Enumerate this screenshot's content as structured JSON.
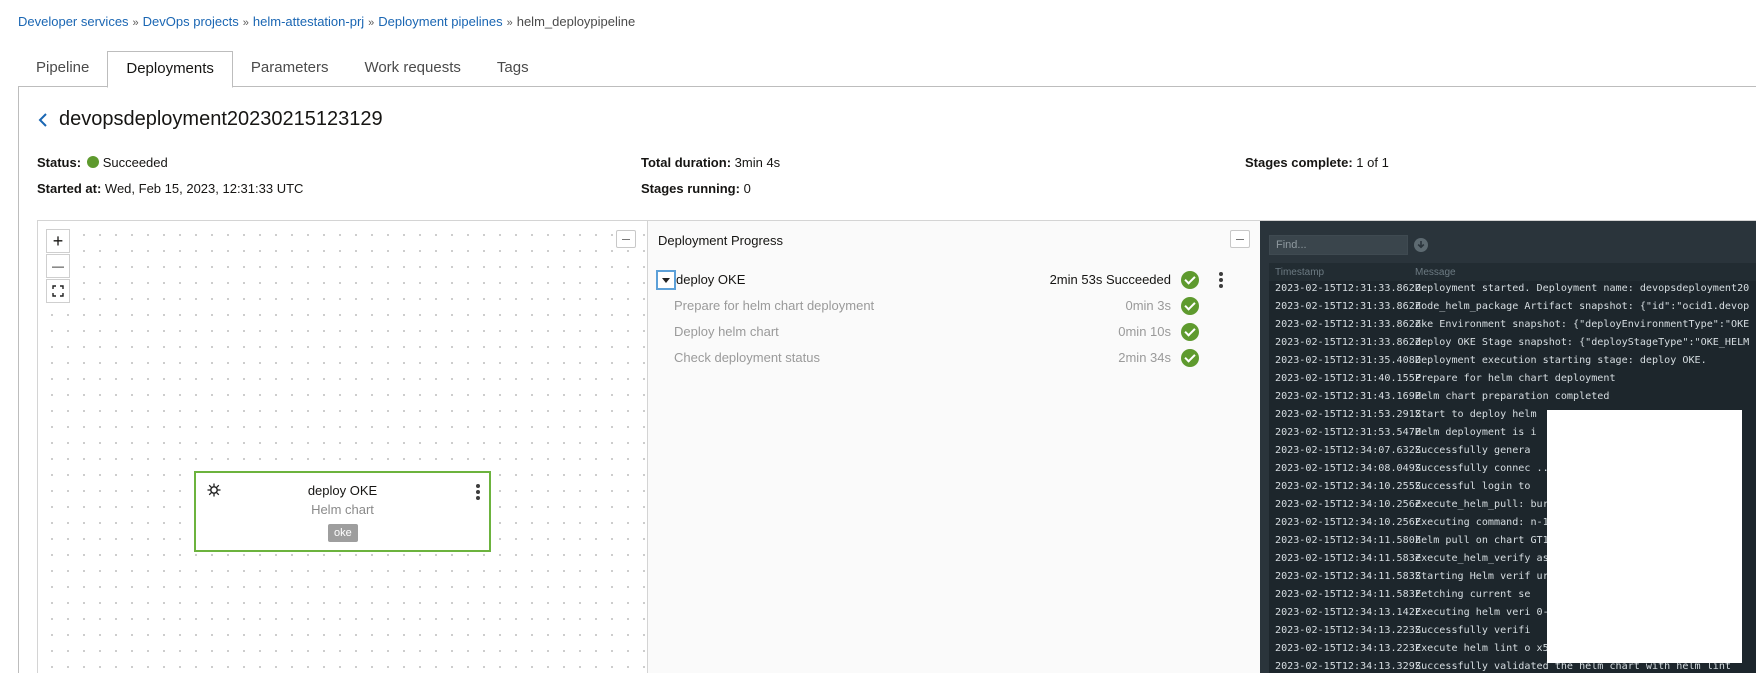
{
  "breadcrumb": {
    "items": [
      "Developer services",
      "DevOps projects",
      "helm-attestation-prj",
      "Deployment pipelines"
    ],
    "current": "helm_deploypipeline",
    "separator": "»"
  },
  "tabs": [
    {
      "label": "Pipeline",
      "active": false
    },
    {
      "label": "Deployments",
      "active": true
    },
    {
      "label": "Parameters",
      "active": false
    },
    {
      "label": "Work requests",
      "active": false
    },
    {
      "label": "Tags",
      "active": false
    }
  ],
  "deployment": {
    "title": "devopsdeployment20230215123129",
    "status_label": "Status:",
    "status_value": "Succeeded",
    "started_label": "Started at:",
    "started_value": "Wed, Feb 15, 2023, 12:31:33 UTC",
    "duration_label": "Total duration:",
    "duration_value": "3min 4s",
    "running_label": "Stages running:",
    "running_value": "0",
    "complete_label": "Stages complete:",
    "complete_value": "1 of 1"
  },
  "canvas": {
    "zoom_in": "+",
    "zoom_out": "—",
    "node": {
      "title": "deploy OKE",
      "subtitle": "Helm chart",
      "tag": "oke"
    }
  },
  "progress": {
    "title": "Deployment Progress",
    "stage": {
      "name": "deploy OKE",
      "time_status": "2min 53s Succeeded"
    },
    "steps": [
      {
        "name": "Prepare for helm chart deployment",
        "time": "0min 3s"
      },
      {
        "name": "Deploy helm chart",
        "time": "0min 10s"
      },
      {
        "name": "Check deployment status",
        "time": "2min 34s"
      }
    ]
  },
  "logs": {
    "find_placeholder": "Find...",
    "col_timestamp": "Timestamp",
    "col_message": "Message",
    "rows": [
      {
        "ts": "2023-02-15T12:31:33.862Z",
        "msg": "Deployment started. Deployment name: devopsdeployment20"
      },
      {
        "ts": "2023-02-15T12:31:33.862Z",
        "msg": "node_helm_package Artifact snapshot: {\"id\":\"ocid1.devop"
      },
      {
        "ts": "2023-02-15T12:31:33.862Z",
        "msg": "oke Environment snapshot: {\"deployEnvironmentType\":\"OKE"
      },
      {
        "ts": "2023-02-15T12:31:33.862Z",
        "msg": "deploy OKE Stage snapshot: {\"deployStageType\":\"OKE_HELM"
      },
      {
        "ts": "2023-02-15T12:31:35.408Z",
        "msg": "Deployment execution starting stage: deploy OKE."
      },
      {
        "ts": "2023-02-15T12:31:40.155Z",
        "msg": "Prepare for helm chart deployment"
      },
      {
        "ts": "2023-02-15T12:31:43.169Z",
        "msg": "Helm chart preparation completed"
      },
      {
        "ts": "2023-02-15T12:31:53.291Z",
        "msg": "Start to deploy helm"
      },
      {
        "ts": "2023-02-15T12:31:53.547Z",
        "msg": "Helm deployment is i"
      },
      {
        "ts": "2023-02-15T12:34:07.632Z",
        "msg": " Successfully genera"
      },
      {
        "ts": "2023-02-15T12:34:08.049Z",
        "msg": " Successfully connec                            ...a"
      },
      {
        "ts": "2023-02-15T12:34:10.255Z",
        "msg": " Successful login to"
      },
      {
        "ts": "2023-02-15T12:34:10.256Z",
        "msg": " execute_helm_pull:                              bur"
      },
      {
        "ts": "2023-02-15T12:34:10.256Z",
        "msg": " Executing command:                              n-1"
      },
      {
        "ts": "2023-02-15T12:34:11.580Z",
        "msg": " helm pull on chart                              GT1"
      },
      {
        "ts": "2023-02-15T12:34:11.583Z",
        "msg": " execute_helm_verify                             as"
      },
      {
        "ts": "2023-02-15T12:34:11.583Z",
        "msg": " Starting Helm verif                             ur"
      },
      {
        "ts": "2023-02-15T12:34:11.583Z",
        "msg": " Fetching current se"
      },
      {
        "ts": "2023-02-15T12:34:13.142Z",
        "msg": " Executing helm veri                             0-"
      },
      {
        "ts": "2023-02-15T12:34:13.223Z",
        "msg": " Successfully verifi"
      },
      {
        "ts": "2023-02-15T12:34:13.223Z",
        "msg": " Execute helm lint o                             x5"
      },
      {
        "ts": "2023-02-15T12:34:13.329Z",
        "msg": " Successfully validated the helm chart with helm lint"
      }
    ]
  },
  "colors": {
    "success": "#5e9a2e",
    "link": "#1a66b3",
    "node_border": "#6cb33e",
    "log_bg": "#2a343b"
  }
}
